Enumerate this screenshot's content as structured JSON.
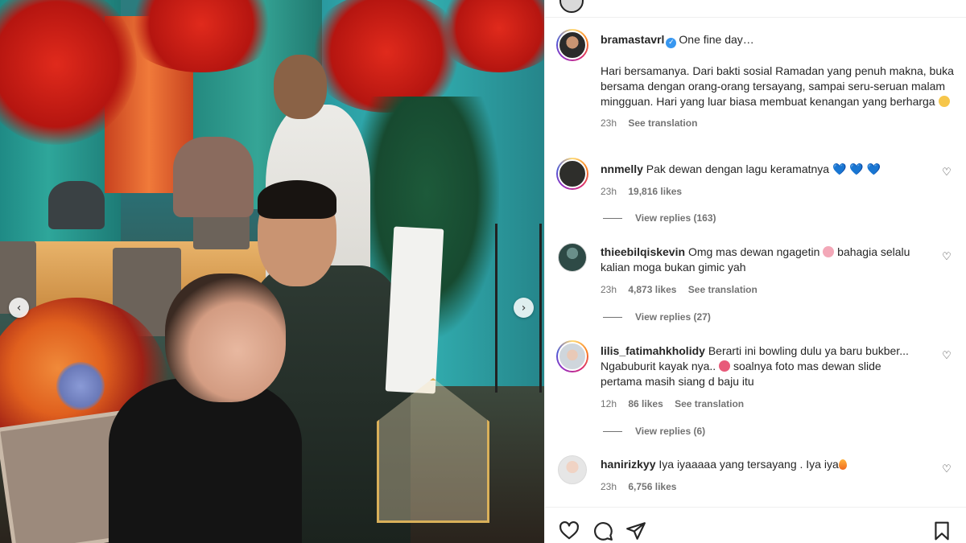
{
  "post": {
    "photo_nav": {
      "prev_icon": "chevron-left-icon",
      "next_icon": "chevron-right-icon"
    },
    "caption": {
      "username": "bramastavrl",
      "verified": true,
      "headline": "One fine day…",
      "body": "Hari bersamanya. Dari bakti sosial Ramadan yang penuh makna, buka bersama dengan orang-orang tersayang, sampai seru-seruan malam mingguan. Hari yang luar biasa membuat kenangan yang berharga",
      "time": "23h",
      "see_translation": "See translation"
    },
    "comments": [
      {
        "username": "nnmelly",
        "text": "Pak dewan dengan lagu keramatnya",
        "emoji": "💙 💙 💙",
        "time": "23h",
        "likes": "19,816 likes",
        "see_translation": "",
        "view_replies": "View replies (163)"
      },
      {
        "username": "thieebilqiskevin",
        "text_before": "Omg mas dewan ngagetin",
        "text_after": "bahagia selalu kalian moga bukan gimic yah",
        "time": "23h",
        "likes": "4,873 likes",
        "see_translation": "See translation",
        "view_replies": "View replies (27)"
      },
      {
        "username": "lilis_fatimahkholidy",
        "text_before": "Berarti ini bowling dulu ya baru bukber... Ngabuburit kayak nya..",
        "text_after": "soalnya foto mas dewan slide pertama masih siang d baju itu",
        "time": "12h",
        "likes": "86 likes",
        "see_translation": "See translation",
        "view_replies": "View replies (6)"
      },
      {
        "username": "hanirizkyy",
        "text": "Iya iyaaaaa yang tersayang . Iya iya",
        "time": "23h",
        "likes": "6,756 likes"
      }
    ],
    "actions": {
      "like_icon": "heart-icon",
      "comment_icon": "comment-icon",
      "share_icon": "share-icon",
      "save_icon": "bookmark-icon"
    }
  }
}
